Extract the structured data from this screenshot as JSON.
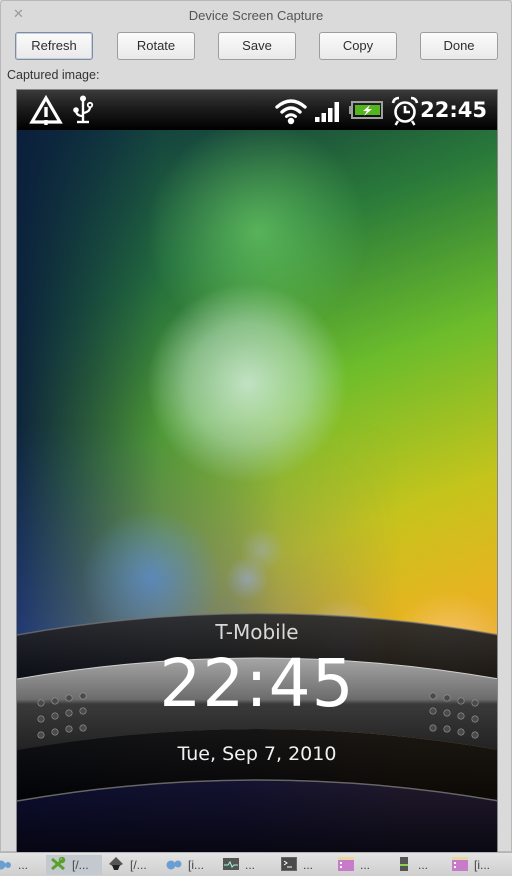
{
  "window": {
    "title": "Device Screen Capture",
    "close_icon": "close-icon"
  },
  "toolbar": {
    "refresh_label": "Refresh",
    "rotate_label": "Rotate",
    "save_label": "Save",
    "copy_label": "Copy",
    "done_label": "Done"
  },
  "captured_label": "Captured image:",
  "device": {
    "statusbar": {
      "left_icons": [
        "warning-icon",
        "usb-icon"
      ],
      "right_icons": [
        "wifi-icon",
        "signal-icon",
        "battery-charging-icon",
        "alarm-icon"
      ],
      "time": "22:45"
    },
    "lockscreen": {
      "carrier": "T-Mobile",
      "clock": "22:45",
      "date": "Tue, Sep 7, 2010"
    }
  },
  "taskbar": {
    "items": [
      {
        "icon": "app-icon-blue-dots",
        "label": "..."
      },
      {
        "icon": "app-icon-green-x",
        "label": "[/...",
        "active": true
      },
      {
        "icon": "inkscape-icon",
        "label": "[/..."
      },
      {
        "icon": "app-icon-blue-dots",
        "label": "[i..."
      },
      {
        "icon": "system-monitor-icon",
        "label": "..."
      },
      {
        "icon": "terminal-icon",
        "label": "..."
      },
      {
        "icon": "window-icon",
        "label": "..."
      },
      {
        "icon": "server-icon",
        "label": "..."
      },
      {
        "icon": "window-icon",
        "label": "[i..."
      }
    ]
  },
  "colors": {
    "battery_fill": "#55b51e",
    "window_bg": "#dadada"
  }
}
